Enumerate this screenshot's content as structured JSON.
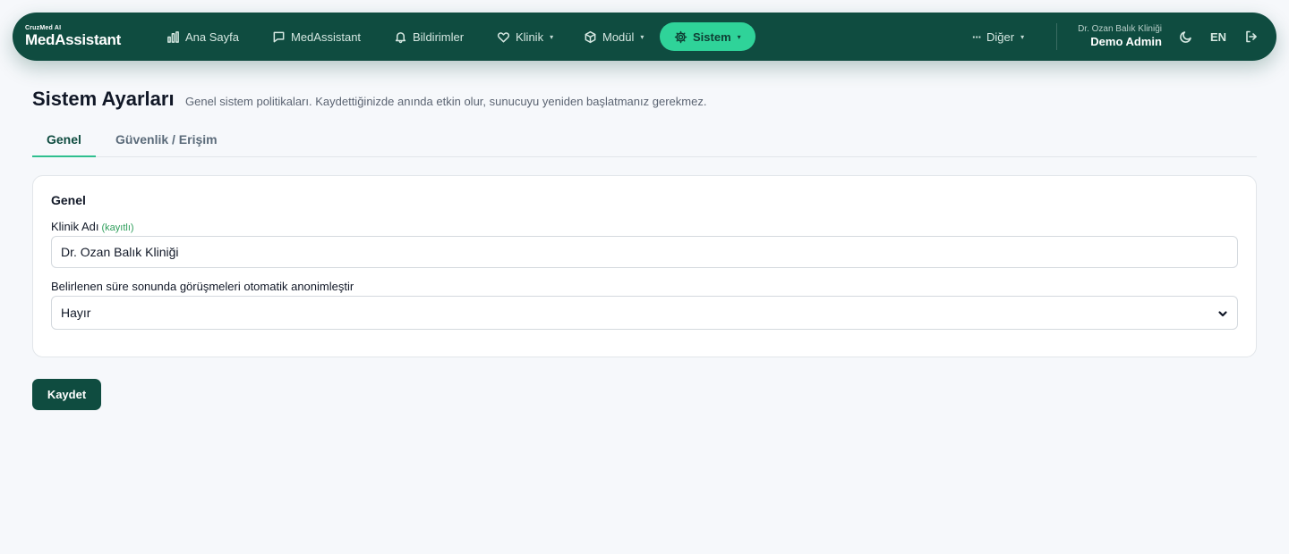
{
  "brand": {
    "small": "CruzMed AI",
    "name": "MedAssistant"
  },
  "nav": {
    "items": [
      {
        "label": "Ana Sayfa",
        "icon": "bar-chart-icon"
      },
      {
        "label": "MedAssistant",
        "icon": "message-square-icon"
      },
      {
        "label": "Bildirimler",
        "icon": "bell-icon"
      },
      {
        "label": "Klinik",
        "icon": "heart-icon",
        "dropdown": true
      },
      {
        "label": "Modül",
        "icon": "box-icon",
        "dropdown": true
      },
      {
        "label": "Sistem",
        "icon": "gear-icon",
        "dropdown": true,
        "active": true
      }
    ],
    "more_label": "Diğer",
    "user_clinic": "Dr. Ozan Balık Kliniği",
    "user_name": "Demo Admin",
    "lang": "EN",
    "caret": "▾",
    "more_icon": "···"
  },
  "page": {
    "title": "Sistem Ayarları",
    "subtitle": "Genel sistem politikaları. Kaydettiğinizde anında etkin olur, sunucuyu yeniden başlatmanız gerekmez."
  },
  "tabs": [
    {
      "label": "Genel",
      "active": true
    },
    {
      "label": "Güvenlik / Erişim",
      "active": false
    }
  ],
  "card": {
    "title": "Genel",
    "clinic_name_label": "Klinik Adı",
    "clinic_name_hint": "(kayıtlı)",
    "clinic_name_value": "Dr. Ozan Balık Kliniği",
    "anon_label": "Belirlenen süre sonunda görüşmeleri otomatik anonimleştir",
    "anon_value": "Hayır"
  },
  "save_label": "Kaydet",
  "colors": {
    "nav_bg": "#0f4c40",
    "accent": "#2fd399",
    "tab_underline": "#2fbf8f",
    "hint": "#2e9e5b",
    "page_bg": "#f6f8fb"
  }
}
